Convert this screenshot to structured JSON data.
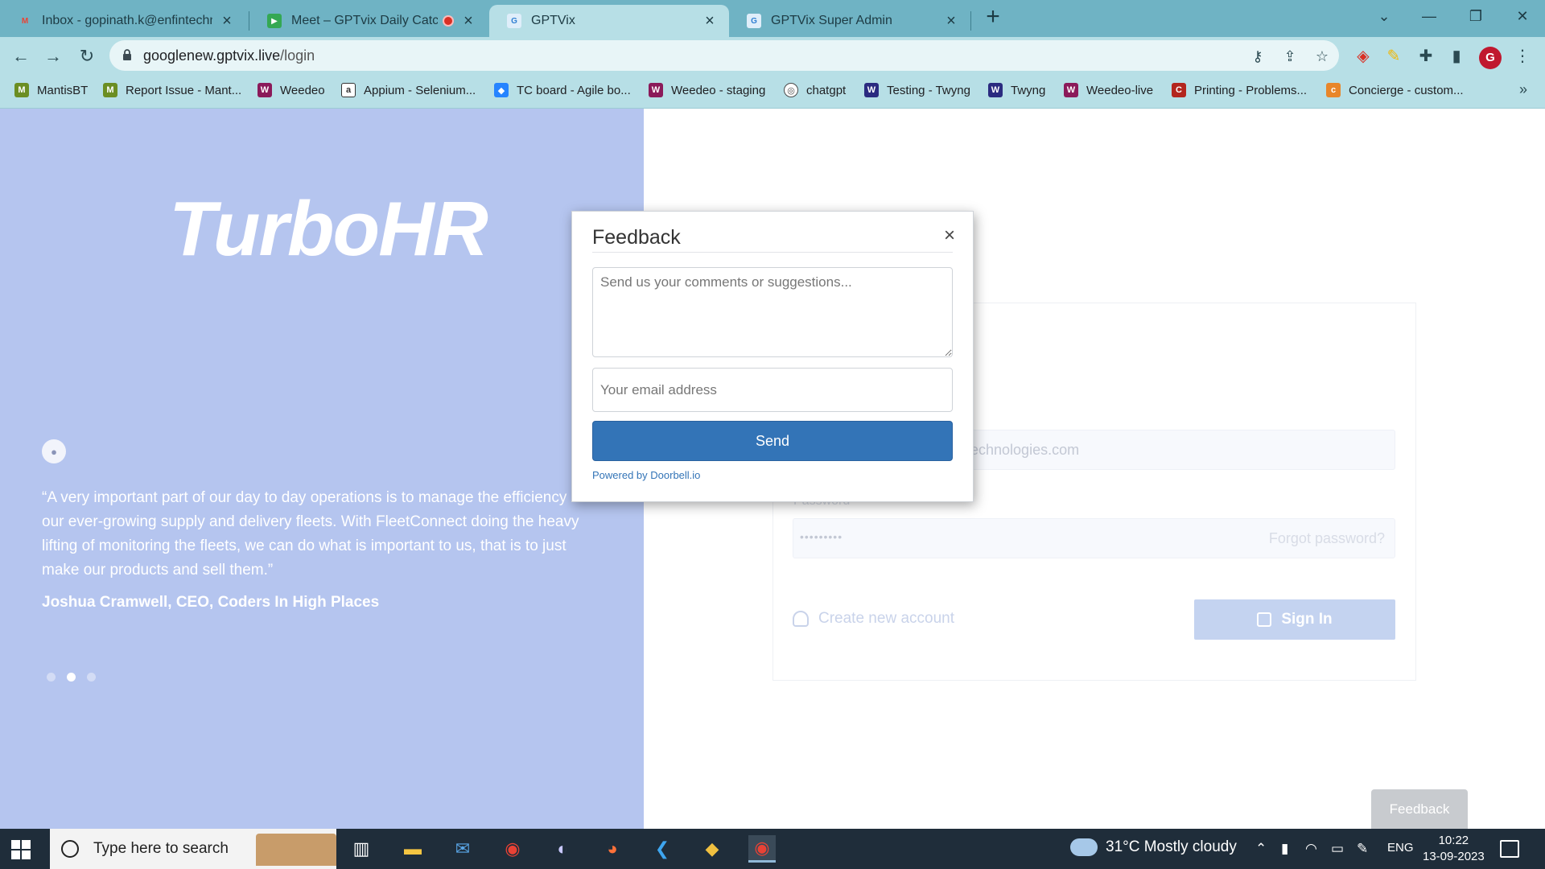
{
  "browser": {
    "tabs": [
      {
        "title": "Inbox - gopinath.k@enfintechnol",
        "icon": "gmail-icon",
        "icon_color": "#ea4335"
      },
      {
        "title": "Meet – GPTvix Daily Catch Up",
        "icon": "meet-icon",
        "icon_color": "#34a853"
      },
      {
        "title": "GPTVix",
        "icon": "gptvix-icon",
        "icon_color": "#2f7fd2"
      },
      {
        "title": "GPTVix Super Admin",
        "icon": "gptvix-icon",
        "icon_color": "#2f7fd2"
      }
    ],
    "url_host": "googlenew.gptvix.live",
    "url_path": "/login",
    "profile_initial": "G",
    "bookmarks": [
      {
        "label": "MantisBT",
        "icon": "mantis-icon",
        "color": "#6b8e23"
      },
      {
        "label": "Report Issue - Mant...",
        "icon": "mantis-icon",
        "color": "#6b8e23"
      },
      {
        "label": "Weedeo",
        "icon": "weedeo-icon",
        "color": "#8b1a5a"
      },
      {
        "label": "Appium - Selenium...",
        "icon": "appium-icon",
        "color": "#555555"
      },
      {
        "label": "TC board - Agile bo...",
        "icon": "jira-icon",
        "color": "#2684ff"
      },
      {
        "label": "Weedeo - staging",
        "icon": "weedeo-icon",
        "color": "#8b1a5a"
      },
      {
        "label": "chatgpt",
        "icon": "chatgpt-icon",
        "color": "#4a4a4a"
      },
      {
        "label": "Testing - Twyng",
        "icon": "twyng-icon",
        "color": "#2b2b80"
      },
      {
        "label": "Twyng",
        "icon": "twyng-icon",
        "color": "#2b2b80"
      },
      {
        "label": "Weedeo-live",
        "icon": "weedeo-icon",
        "color": "#8b1a5a"
      },
      {
        "label": "Printing - Problems...",
        "icon": "cc-icon",
        "color": "#b3261e"
      },
      {
        "label": "Concierge - custom...",
        "icon": "concierge-icon",
        "color": "#e8862a"
      }
    ]
  },
  "page": {
    "logo": "TurboHR",
    "quote": "“A very important part of our day to day operations is to manage the efficiency of our ever-growing supply and delivery fleets. With FleetConnect doing the heavy lifting of monitoring the fleets, we can do what is important to us, that is to just make our products and sell them.”",
    "quote_author": "Joshua Cramwell, CEO, Coders In High Places",
    "email_partial": "echnologies.com",
    "password_label": "Password",
    "password_mask": "•••••••••",
    "forgot_password": "Forgot password?",
    "create_account": "Create new account",
    "sign_in": "Sign In",
    "feedback_tab": "Feedback"
  },
  "feedback_modal": {
    "title": "Feedback",
    "close": "×",
    "comments_placeholder": "Send us your comments or suggestions...",
    "email_placeholder": "Your email address",
    "send": "Send",
    "powered_by": "Powered by Doorbell.io"
  },
  "taskbar": {
    "search_placeholder": "Type here to search",
    "weather": "31°C  Mostly cloudy",
    "language": "ENG",
    "time": "10:22",
    "date": "13-09-2023"
  }
}
